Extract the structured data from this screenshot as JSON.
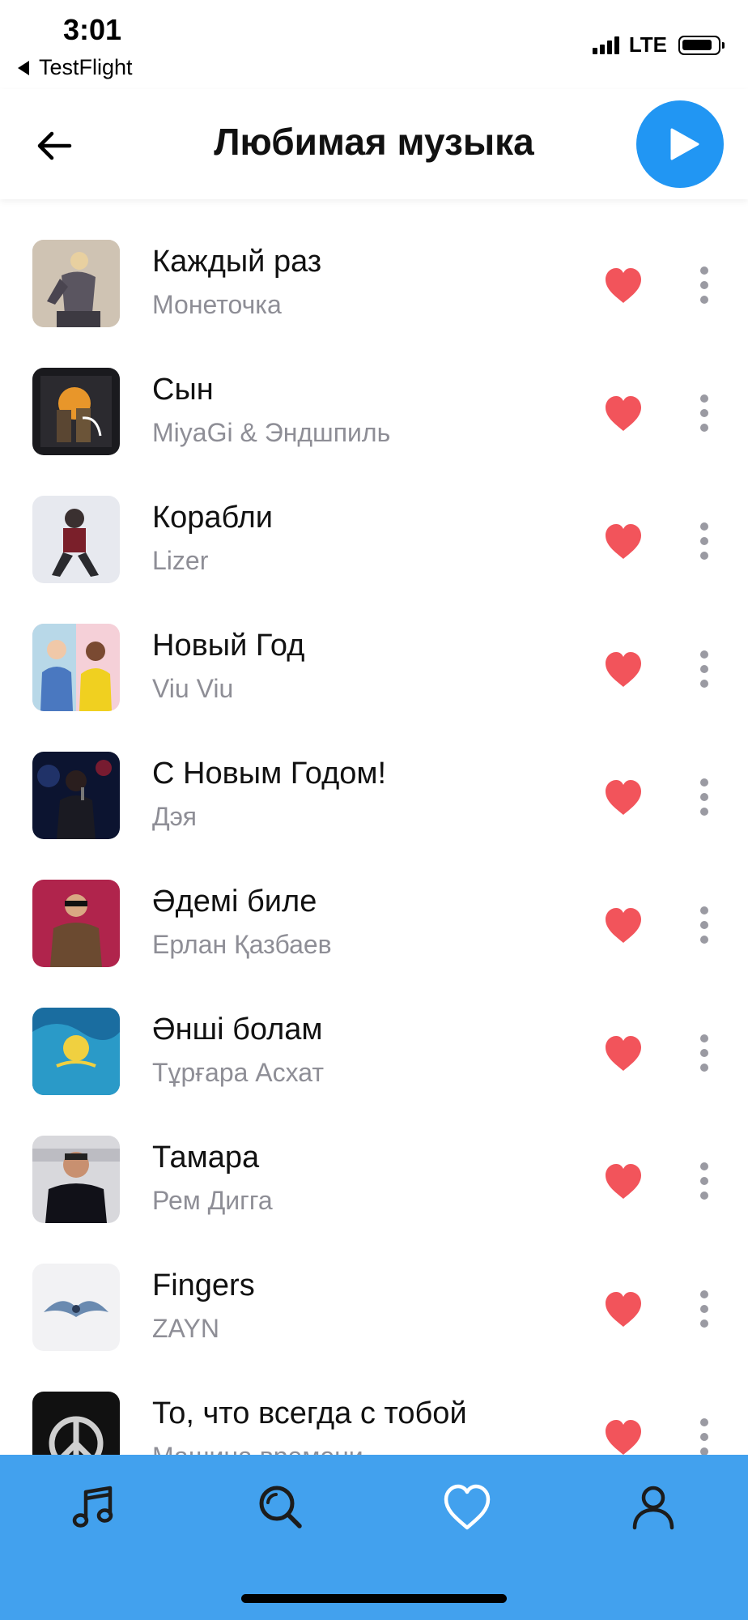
{
  "status_bar": {
    "time": "3:01",
    "back_app": "TestFlight",
    "carrier": "LTE"
  },
  "header": {
    "title": "Любимая музыка",
    "back_icon": "arrow-left-icon",
    "play_icon": "play-icon"
  },
  "tracks": [
    {
      "title": "Каждый раз",
      "artist": "Монеточка",
      "liked": true
    },
    {
      "title": "Сын",
      "artist": "MiyaGi & Эндшпиль",
      "liked": true
    },
    {
      "title": "Корабли",
      "artist": "Lizer",
      "liked": true
    },
    {
      "title": "Новый Год",
      "artist": "Viu Viu",
      "liked": true
    },
    {
      "title": "С Новым Годом!",
      "artist": "Дэя",
      "liked": true
    },
    {
      "title": "Әдемі биле",
      "artist": "Ерлан Қазбаев",
      "liked": true
    },
    {
      "title": "Әнші болам",
      "artist": "Тұрғара Асхат",
      "liked": true
    },
    {
      "title": "Тамара",
      "artist": "Рем Дигга",
      "liked": true
    },
    {
      "title": "Fingers",
      "artist": "ZAYN",
      "liked": true
    },
    {
      "title": "То, что всегда с тобой",
      "artist": "Машина времени",
      "liked": true
    }
  ],
  "bottom_nav": {
    "items": [
      {
        "icon": "music-note-icon",
        "active": false
      },
      {
        "icon": "search-icon",
        "active": false
      },
      {
        "icon": "heart-icon",
        "active": true
      },
      {
        "icon": "profile-icon",
        "active": false
      }
    ]
  },
  "colors": {
    "accent": "#2196f3",
    "nav_background": "#42a1ee",
    "heart": "#f2545b",
    "artist_text": "#8e8e96"
  }
}
